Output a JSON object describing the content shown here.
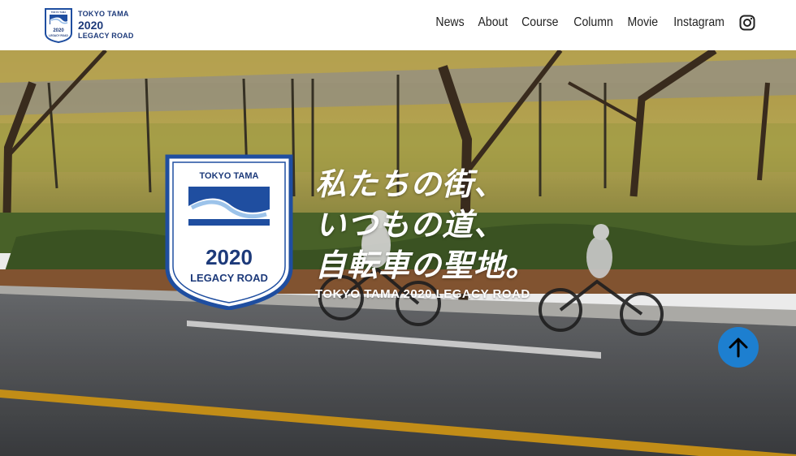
{
  "header": {
    "logo": {
      "line1": "TOKYO TAMA",
      "line2": "2020",
      "line3": "LEGACY ROAD"
    },
    "nav": [
      {
        "label": "News"
      },
      {
        "label": "About"
      },
      {
        "label": "Course"
      },
      {
        "label": "Column"
      },
      {
        "label": "Movie"
      },
      {
        "label": "Instagram"
      }
    ],
    "instagram_icon": "instagram-icon"
  },
  "hero": {
    "emblem": {
      "line1": "TOKYO TAMA",
      "line2": "2020",
      "line3": "LEGACY ROAD"
    },
    "headline": [
      "私たちの街、",
      "いつもの道、",
      "自転車の聖地。"
    ],
    "subline": "TOKYO TAMA 2020 LEGACY ROAD",
    "back_to_top_icon": "arrow-up-icon"
  },
  "colors": {
    "brand_navy": "#1d3a7a",
    "brand_blue": "#1f4ea0",
    "accent_blue": "#1d7fd0"
  }
}
